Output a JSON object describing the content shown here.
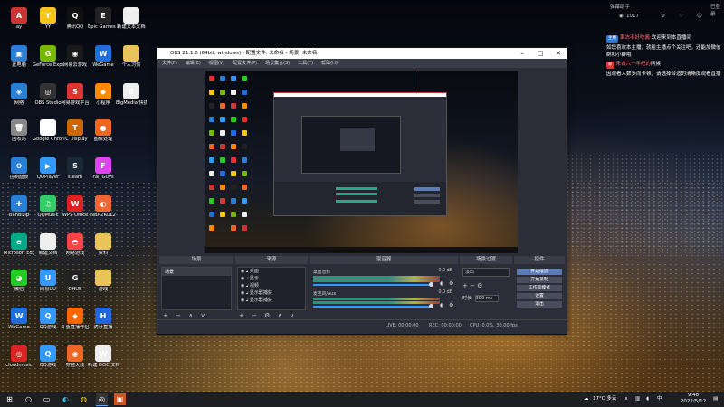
{
  "desktop_icons": [
    {
      "label": "ay",
      "color": "#c33",
      "glyph": "A"
    },
    {
      "label": "YY",
      "color": "#f5c518",
      "glyph": "Y"
    },
    {
      "label": "腾讯QQ",
      "color": "#111",
      "glyph": "Q"
    },
    {
      "label": "Epic Games Launcher",
      "color": "#222",
      "glyph": "E"
    },
    {
      "label": "新建文本文档",
      "color": "#eee",
      "glyph": ""
    },
    {
      "label": "此电脑",
      "color": "#2a7fd4",
      "glyph": "▣"
    },
    {
      "label": "GeForce Experience",
      "color": "#76b900",
      "glyph": "G"
    },
    {
      "label": "网易云游戏",
      "color": "#1a1a1a",
      "glyph": "◉"
    },
    {
      "label": "WeGame",
      "color": "#1e6fd9",
      "glyph": "W"
    },
    {
      "label": "个人习惯",
      "color": "#e8c35a",
      "glyph": ""
    },
    {
      "label": "网络",
      "color": "#2a7fd4",
      "glyph": "◈"
    },
    {
      "label": "OBS Studio",
      "color": "#333",
      "glyph": "◎"
    },
    {
      "label": "网易游戏平台",
      "color": "#d33",
      "glyph": "S"
    },
    {
      "label": "小程序",
      "color": "#f80",
      "glyph": "◆"
    },
    {
      "label": "BigMedia 快捷方式",
      "color": "#eee",
      "glyph": "B"
    },
    {
      "label": "回收站",
      "color": "#888",
      "glyph": "🗑"
    },
    {
      "label": "Google Chrome",
      "color": "#fff",
      "glyph": "◍"
    },
    {
      "label": "TC Display",
      "color": "#c60",
      "glyph": "T"
    },
    {
      "label": "图像处理",
      "color": "#e62",
      "glyph": "●"
    },
    {
      "label": "控制面板",
      "color": "#2a7fd4",
      "glyph": "⚙"
    },
    {
      "label": "QQPlayer",
      "color": "#39f",
      "glyph": "▶"
    },
    {
      "label": "steam",
      "color": "#1b2838",
      "glyph": "S"
    },
    {
      "label": "Fall Guys",
      "color": "#d4e",
      "glyph": "F"
    },
    {
      "label": "Bandizip",
      "color": "#2a7fd4",
      "glyph": "✚"
    },
    {
      "label": "QQMusic",
      "color": "#3c6",
      "glyph": "♫"
    },
    {
      "label": "WPS Office",
      "color": "#d22",
      "glyph": "W"
    },
    {
      "label": "NBA2KOL2",
      "color": "#e63",
      "glyph": "◐"
    },
    {
      "label": "Microsoft Edge",
      "color": "#0a8",
      "glyph": "e"
    },
    {
      "label": "新建文档",
      "color": "#eee",
      "glyph": ""
    },
    {
      "label": "网易游戏",
      "color": "#f44",
      "glyph": "◓"
    },
    {
      "label": "资料",
      "color": "#e8c35a",
      "glyph": ""
    },
    {
      "label": "微信",
      "color": "#2c2",
      "glyph": "◕"
    },
    {
      "label": "网易UU",
      "color": "#39f",
      "glyph": "U"
    },
    {
      "label": "GHUB",
      "color": "#222",
      "glyph": "G"
    },
    {
      "label": "游戏",
      "color": "#e8c35a",
      "glyph": ""
    },
    {
      "label": "WeGame",
      "color": "#1e6fd9",
      "glyph": "W"
    },
    {
      "label": "QQ游戏",
      "color": "#39f",
      "glyph": "Q"
    },
    {
      "label": "斗鱼直播伴侣",
      "color": "#f60",
      "glyph": "◆"
    },
    {
      "label": "虎牙直播",
      "color": "#26d",
      "glyph": "H"
    },
    {
      "label": "cloudmusic",
      "color": "#d22",
      "glyph": "◎"
    },
    {
      "label": "QQ游戏",
      "color": "#39f",
      "glyph": "Q"
    },
    {
      "label": "穿越火线",
      "color": "#e62",
      "glyph": "◉"
    },
    {
      "label": "新建 DOC 文档",
      "color": "#eee",
      "glyph": "W"
    }
  ],
  "stream": {
    "title": "弹幕助手",
    "viewers": "1017",
    "top_right": "已登录",
    "chat": [
      {
        "badge": "主播",
        "user": "果冻不好吃酱:",
        "text": "欢迎来到本直播间",
        "badge_style": "b"
      },
      {
        "badge": "",
        "user": "",
        "text": "如您喜欢本主播，就给主播点个关注吧，还能加微信群和小群哦",
        "badge_style": ""
      },
      {
        "badge": "新",
        "user": "来自六十年纪的",
        "text": "问候",
        "badge_style": ""
      },
      {
        "badge": "",
        "user": "",
        "text": "因观看人数多而卡顿，请选择合适的清晰度观看直播",
        "badge_style": ""
      }
    ]
  },
  "obs": {
    "title": "OBS 21.1.0 (64bit, windows) - 配置文件: 未命名 - 场景: 未命名",
    "menu": [
      "文件(F)",
      "编辑(E)",
      "视图(V)",
      "配置文件(P)",
      "场景集合(S)",
      "工具(T)",
      "帮助(H)"
    ],
    "docks": {
      "scenes": {
        "title": "场景",
        "items": [
          "场景"
        ]
      },
      "sources": {
        "title": "来源",
        "items": [
          "桌面",
          "显示",
          "视频",
          "显示器捕获",
          "显示器捕获"
        ]
      },
      "mixer": {
        "title": "混音器",
        "tracks": [
          {
            "name": "桌面音频",
            "db": "0.0 dB"
          },
          {
            "name": "麦克风/Aux",
            "db": "0.0 dB"
          }
        ]
      },
      "transitions": {
        "title": "场景过渡",
        "type": "淡出",
        "duration_label": "时长",
        "duration": "300 ms"
      },
      "controls": {
        "title": "控件",
        "buttons": [
          "开始推流",
          "开始录制",
          "工作室模式",
          "设置",
          "退出"
        ]
      }
    },
    "status": {
      "live": "LIVE: 00:00:00",
      "rec": "REC: 00:00:00",
      "cpu": "CPU: 0.0%, 30.00 fps"
    }
  },
  "taskbar": {
    "weather": "17°C 多云",
    "time": "9:48",
    "date": "2022/5/12",
    "lang": "中",
    "icons": [
      "windows-icon",
      "search-icon",
      "task-view-icon",
      "edge-icon",
      "chrome-icon",
      "obs-icon",
      "app-icon"
    ]
  }
}
